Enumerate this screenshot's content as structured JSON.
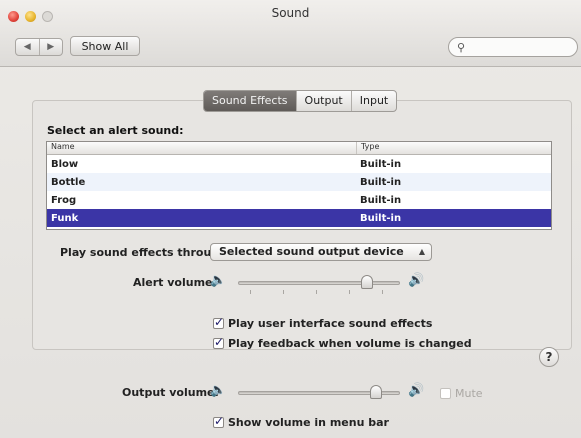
{
  "window": {
    "title": "Sound"
  },
  "toolbar": {
    "back_icon": "◀",
    "forward_icon": "▶",
    "show_all_label": "Show All",
    "search_icon": "🔍",
    "search_placeholder": ""
  },
  "tabs": [
    {
      "label": "Sound Effects",
      "active": true
    },
    {
      "label": "Output",
      "active": false
    },
    {
      "label": "Input",
      "active": false
    }
  ],
  "sound_effects": {
    "section_label": "Select an alert sound:",
    "columns": {
      "name": "Name",
      "type": "Type"
    },
    "sounds": [
      {
        "name": "Blow",
        "type": "Built-in"
      },
      {
        "name": "Bottle",
        "type": "Built-in"
      },
      {
        "name": "Frog",
        "type": "Built-in"
      },
      {
        "name": "Funk",
        "type": "Built-in",
        "selected": true
      }
    ],
    "play_through_label": "Play sound effects through:",
    "play_through_value": "Selected sound output device",
    "alert_volume_label": "Alert volume:",
    "alert_volume_level": 0.82,
    "ui_sounds_label": "Play user interface sound effects",
    "ui_sounds_checked": true,
    "feedback_label": "Play feedback when volume is changed",
    "feedback_checked": true
  },
  "output": {
    "output_volume_label": "Output volume:",
    "output_volume_level": 0.88,
    "mute_label": "Mute",
    "show_volume_label": "Show volume in menu bar",
    "show_volume_checked": true
  },
  "help": {
    "label": "?"
  },
  "colors": {
    "selection": "#3b35a6",
    "active_tab": "#6b6764"
  }
}
